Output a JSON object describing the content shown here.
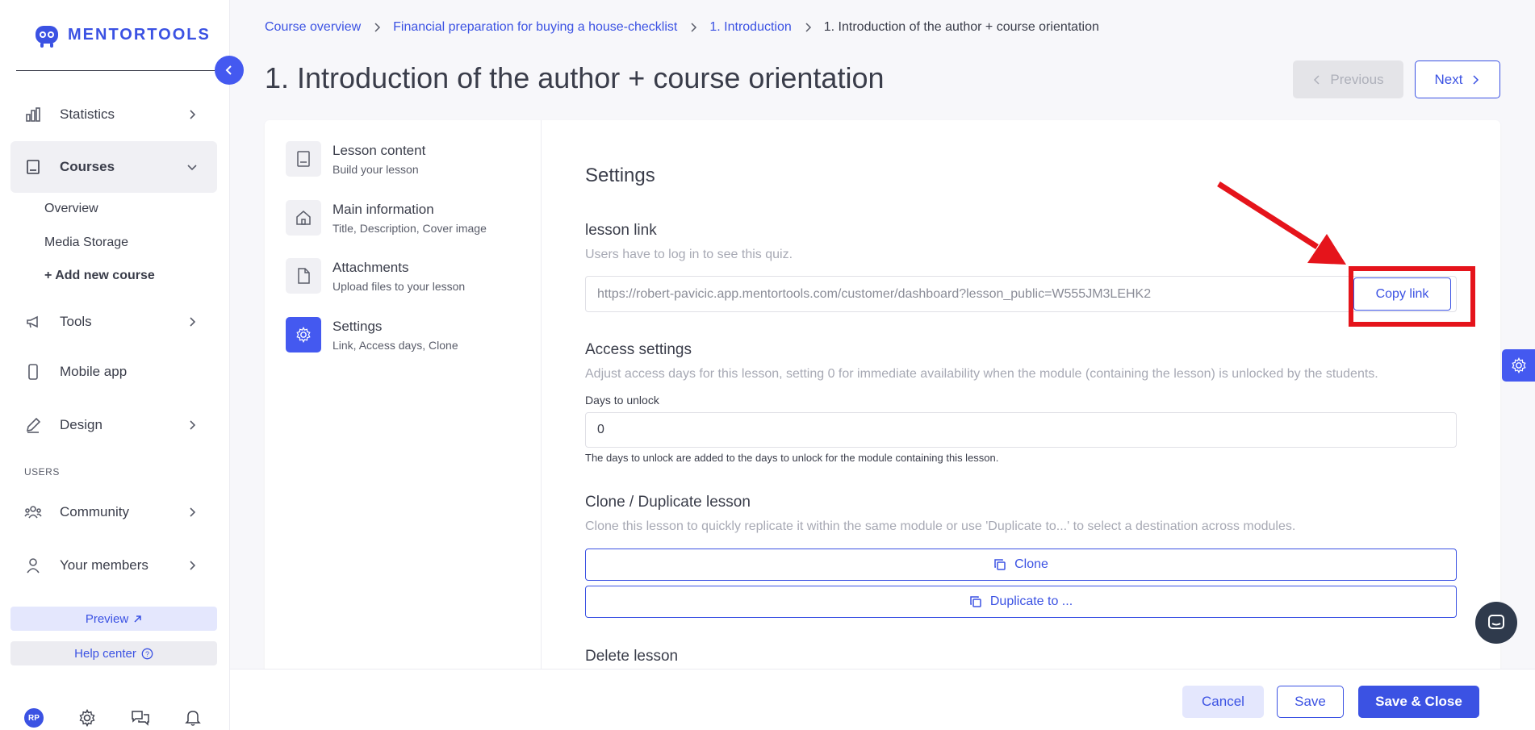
{
  "app": {
    "logo_text": "MENTORTOOLS"
  },
  "sidebar": {
    "items": [
      {
        "label": "Statistics",
        "icon": "bar-chart-icon"
      },
      {
        "label": "Courses",
        "icon": "book-icon"
      },
      {
        "label": "Tools",
        "icon": "megaphone-icon"
      },
      {
        "label": "Mobile app",
        "icon": "mobile-icon"
      },
      {
        "label": "Design",
        "icon": "pencil-icon"
      },
      {
        "label": "Community",
        "icon": "users-icon"
      },
      {
        "label": "Your members",
        "icon": "user-icon"
      }
    ],
    "courses_sub": [
      "Overview",
      "Media Storage",
      "+ Add new course"
    ],
    "section_users": "USERS",
    "preview_label": "Preview",
    "help_label": "Help center",
    "avatar_initials": "RP"
  },
  "breadcrumb": [
    "Course overview",
    "Financial preparation for buying a house-checklist",
    "1. Introduction",
    "1. Introduction of the author + course orientation"
  ],
  "page": {
    "title": "1. Introduction of the author + course orientation",
    "prev_label": "Previous",
    "next_label": "Next"
  },
  "lesson_nav": [
    {
      "title": "Lesson content",
      "subtitle": "Build your lesson",
      "icon": "book-icon"
    },
    {
      "title": "Main information",
      "subtitle": "Title, Description, Cover image",
      "icon": "home-icon"
    },
    {
      "title": "Attachments",
      "subtitle": "Upload files to your lesson",
      "icon": "file-icon"
    },
    {
      "title": "Settings",
      "subtitle": "Link, Access days, Clone",
      "icon": "gear-icon",
      "active": true
    }
  ],
  "settings": {
    "heading": "Settings",
    "lesson_link": {
      "title": "lesson link",
      "desc": "Users have to log in to see this quiz.",
      "url": "https://robert-pavicic.app.mentortools.com/customer/dashboard?lesson_public=W555JM3LEHK2",
      "copy_label": "Copy link"
    },
    "access": {
      "title": "Access settings",
      "desc": "Adjust access days for this lesson, setting 0 for immediate availability when the module (containing the lesson) is unlocked by the students.",
      "field_label": "Days to unlock",
      "value": "0",
      "help": "The days to unlock are added to the days to unlock for the module containing this lesson."
    },
    "clone": {
      "title": "Clone / Duplicate lesson",
      "desc": "Clone this lesson to quickly replicate it within the same module or use 'Duplicate to...' to select a destination across modules.",
      "clone_label": "Clone",
      "duplicate_label": "Duplicate to ..."
    },
    "delete": {
      "title": "Delete lesson"
    }
  },
  "footer": {
    "cancel": "Cancel",
    "save": "Save",
    "save_close": "Save & Close"
  },
  "colors": {
    "accent": "#3b52e3",
    "annotation": "#e5141b"
  }
}
